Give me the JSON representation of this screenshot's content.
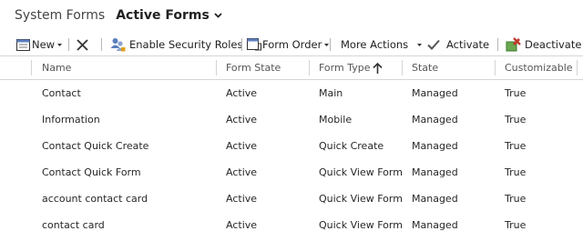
{
  "breadcrumb": {
    "area": "System Forms",
    "view": "Active Forms"
  },
  "toolbar": {
    "new_label": "New",
    "enable_security_label": "Enable Security Roles",
    "form_order_label": "Form Order",
    "more_actions_label": "More Actions",
    "activate_label": "Activate",
    "deactivate_label": "Deactivate"
  },
  "columns": [
    "Name",
    "Form State",
    "Form Type",
    "State",
    "Customizable"
  ],
  "sort": {
    "column": "Form Type",
    "direction": "ascending"
  },
  "rows": [
    [
      "Contact",
      "Active",
      "Main",
      "Managed",
      "True"
    ],
    [
      "Information",
      "Active",
      "Mobile",
      "Managed",
      "True"
    ],
    [
      "Contact Quick Create",
      "Active",
      "Quick Create",
      "Managed",
      "True"
    ],
    [
      "Contact Quick Form",
      "Active",
      "Quick View Form",
      "Managed",
      "True"
    ],
    [
      "account contact card",
      "Active",
      "Quick View Form",
      "Managed",
      "True"
    ],
    [
      "contact card",
      "Active",
      "Quick View Form",
      "Managed",
      "True"
    ]
  ],
  "colors": {
    "separator": "#d6d6d6",
    "activate_check": "#555555",
    "delete_x": "#333333"
  }
}
